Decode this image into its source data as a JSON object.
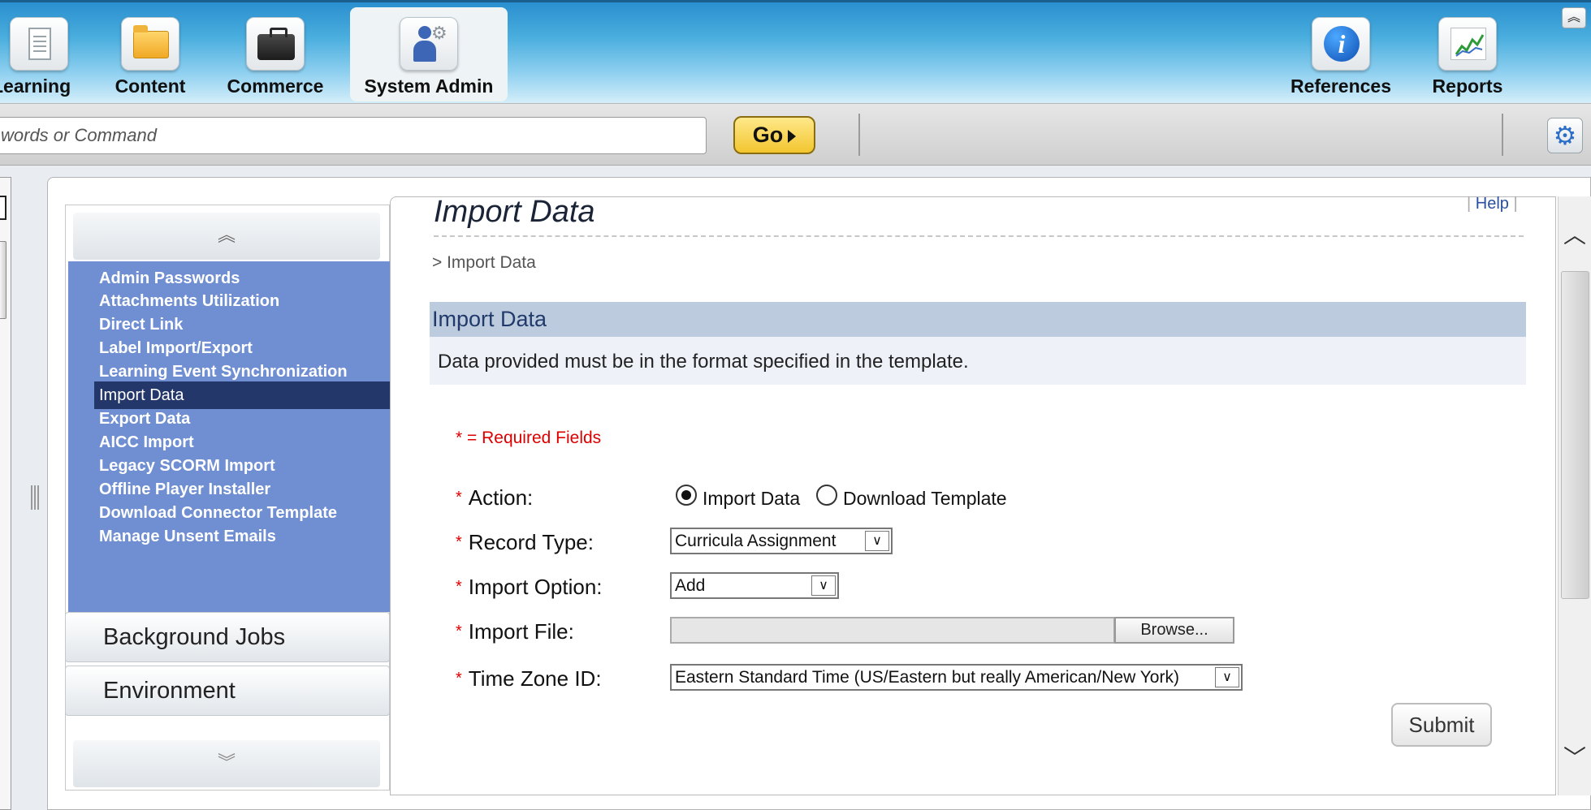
{
  "nav": {
    "tabs": [
      {
        "label": "Learning",
        "icon": "document-icon"
      },
      {
        "label": "Content",
        "icon": "folder-icon"
      },
      {
        "label": "Commerce",
        "icon": "briefcase-icon"
      },
      {
        "label": "System Admin",
        "icon": "admin-user-gear-icon",
        "active": true
      },
      {
        "label": "References",
        "icon": "info-icon"
      },
      {
        "label": "Reports",
        "icon": "chart-icon"
      }
    ],
    "collapse_glyph": "︽"
  },
  "search": {
    "placeholder": "Search by Keywords or Command",
    "value": "words or Command",
    "go_label": "Go"
  },
  "sidebar": {
    "items": [
      "Admin Passwords",
      "Attachments Utilization",
      "Direct Link",
      "Label Import/Export",
      "Learning Event Synchronization",
      "Import Data",
      "Export Data",
      "AICC Import",
      "Legacy SCORM Import",
      "Offline Player Installer",
      "Download Connector Template",
      "Manage Unsent Emails"
    ],
    "selected": "Import Data",
    "sections": [
      "Background Jobs",
      "Environment"
    ],
    "up_glyph": "︽",
    "down_glyph": "︾"
  },
  "page": {
    "title": "Import Data",
    "help": "Help",
    "breadcrumb": "> Import Data",
    "section_title": "Import Data",
    "section_desc": "Data provided must be in the format specified in the template.",
    "required_note": "* = Required Fields"
  },
  "form": {
    "action_label": "Action:",
    "action_options": [
      "Import Data",
      "Download Template"
    ],
    "action_selected": "Import Data",
    "record_type_label": "Record Type:",
    "record_type_value": "Curricula Assignment",
    "import_option_label": "Import Option:",
    "import_option_value": "Add",
    "import_file_label": "Import File:",
    "browse_label": "Browse...",
    "tz_label": "Time Zone ID:",
    "tz_value": "Eastern Standard Time (US/Eastern but really American/New York)",
    "submit_label": "Submit",
    "required_star": "*",
    "dropdown_glyph": "∨"
  },
  "colors": {
    "menu_bg": "#6f8fd2",
    "menu_selected": "#23376b",
    "required": "#dd0000",
    "section_head": "#bccbdd"
  }
}
